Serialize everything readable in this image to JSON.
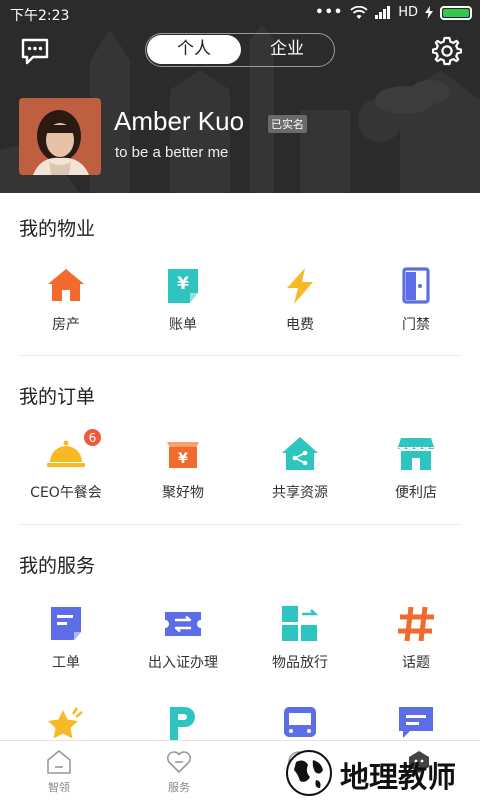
{
  "status_bar": {
    "time": "下午2:23",
    "dots": "•••",
    "network": "HD"
  },
  "header": {
    "tabs": [
      {
        "label": "个人",
        "active": true
      },
      {
        "label": "企业",
        "active": false
      }
    ],
    "user": {
      "name": "Amber Kuo",
      "verified": "已实名",
      "motto": "to be a better me"
    }
  },
  "sections": [
    {
      "title": "我的物业",
      "items": [
        {
          "label": "房产",
          "icon": "house-icon",
          "color": "#f26a2e"
        },
        {
          "label": "账单",
          "icon": "bill-icon",
          "color": "#2ec4c0"
        },
        {
          "label": "电费",
          "icon": "lightning-icon",
          "color": "#f7b924"
        },
        {
          "label": "门禁",
          "icon": "door-icon",
          "color": "#5b6ee8"
        }
      ]
    },
    {
      "title": "我的订单",
      "items": [
        {
          "label": "CEO午餐会",
          "icon": "food-cover-icon",
          "color": "#f7b924",
          "badge": "6"
        },
        {
          "label": "聚好物",
          "icon": "shopping-box-icon",
          "color": "#f26a2e"
        },
        {
          "label": "共享资源",
          "icon": "share-house-icon",
          "color": "#2ec4c0"
        },
        {
          "label": "便利店",
          "icon": "store-icon",
          "color": "#2ec4c0"
        }
      ]
    },
    {
      "title": "我的服务",
      "items": [
        {
          "label": "工单",
          "icon": "document-icon",
          "color": "#5b6ee8"
        },
        {
          "label": "出入证办理",
          "icon": "ticket-icon",
          "color": "#5b6ee8"
        },
        {
          "label": "物品放行",
          "icon": "release-icon",
          "color": "#2ec4c0"
        },
        {
          "label": "话题",
          "icon": "hashtag-icon",
          "color": "#f26a2e"
        }
      ]
    },
    {
      "title": "",
      "items": [
        {
          "label": "",
          "icon": "star-icon",
          "color": "#f7b924"
        },
        {
          "label": "",
          "icon": "parking-icon",
          "color": "#2ec4c0"
        },
        {
          "label": "",
          "icon": "bus-icon",
          "color": "#5b6ee8"
        },
        {
          "label": "",
          "icon": "chat-message-icon",
          "color": "#5b6ee8"
        }
      ]
    }
  ],
  "tabbar": {
    "items": [
      {
        "label": "智领",
        "icon": "home-tab-icon"
      },
      {
        "label": "服务",
        "icon": "heart-tab-icon"
      },
      {
        "label": "",
        "icon": "discover-tab-icon"
      },
      {
        "label": "",
        "icon": "profile-tab-icon"
      }
    ]
  },
  "watermark": {
    "text": "地理教师"
  }
}
